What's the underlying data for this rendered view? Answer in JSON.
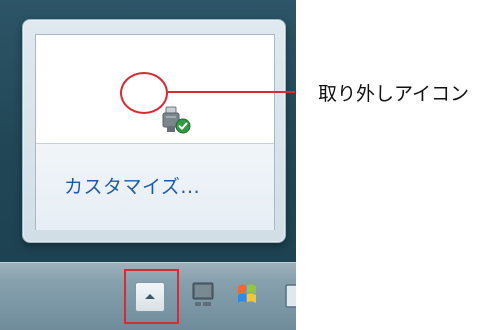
{
  "callout": {
    "label": "取り外しアイコン"
  },
  "tray_popup": {
    "customize_label": "カスタマイズ..."
  },
  "icons": {
    "safe_remove": "safely-remove-hardware-icon",
    "show_hidden": "show-hidden-icons-icon",
    "network": "monitor-icon",
    "action_center": "windows-flag-icon",
    "partial": "partial-tray-icon"
  },
  "colors": {
    "accent_red": "#d72b35",
    "link_blue": "#1f5aa7",
    "taskbar_top": "#9eb1bb",
    "taskbar_bottom": "#6f8c9b"
  }
}
